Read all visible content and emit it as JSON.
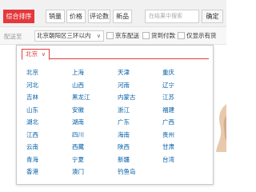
{
  "toolbar": {
    "sort_tabs": [
      {
        "label": "综合排序",
        "active": true
      },
      {
        "label": "销量",
        "active": false
      },
      {
        "label": "价格",
        "active": false
      },
      {
        "label": "评论数",
        "active": false
      },
      {
        "label": "新品",
        "active": false
      }
    ],
    "search_placeholder": "在结果中搜索",
    "confirm_label": "确定"
  },
  "filter": {
    "ship_to_label": "配送至",
    "address": "北京朝阳区三环以内",
    "options": [
      {
        "label": "京东配送",
        "checked": false
      },
      {
        "label": "货到付款",
        "checked": false
      },
      {
        "label": "仅显示有货",
        "checked": false
      }
    ]
  },
  "region_panel": {
    "current_tab": "北京",
    "cities": [
      "北京",
      "上海",
      "天津",
      "重庆",
      "河北",
      "山西",
      "河南",
      "辽宁",
      "吉林",
      "黑龙江",
      "内蒙古",
      "江苏",
      "山东",
      "安徽",
      "浙江",
      "福建",
      "湖北",
      "湖南",
      "广东",
      "广西",
      "江西",
      "四川",
      "海南",
      "贵州",
      "云南",
      "西藏",
      "陕西",
      "甘肃",
      "青海",
      "宁夏",
      "新疆",
      "台湾",
      "香港",
      "澳门",
      "钓鱼岛"
    ]
  },
  "colors": {
    "accent": "#e4393c",
    "link": "#005ea7"
  }
}
